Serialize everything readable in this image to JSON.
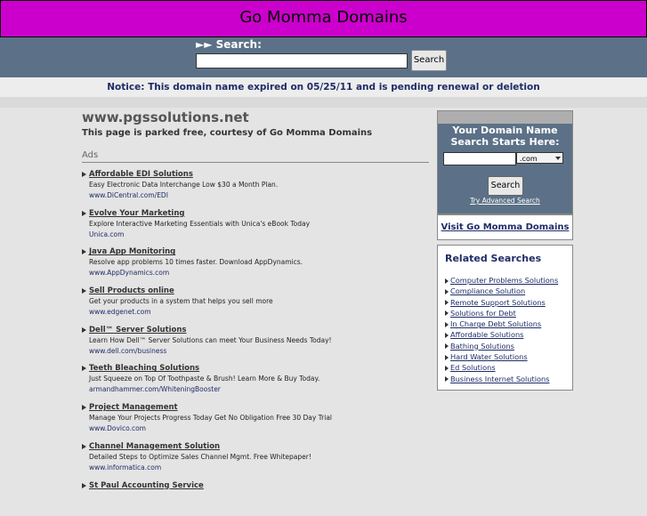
{
  "header": {
    "title": "Go Momma Domains"
  },
  "search": {
    "label": "►► Search:",
    "button": "Search",
    "value": ""
  },
  "notice": "Notice: This domain name expired on 05/25/11 and is pending renewal or deletion",
  "main": {
    "domain": "www.pgssolutions.net",
    "subtitle": "This page is parked free, courtesy of Go Momma Domains",
    "ads_label": "Ads",
    "ads": [
      {
        "title": "Affordable EDI Solutions",
        "desc": "Easy Electronic Data Interchange Low $30 a Month Plan.",
        "url": "www.DiCentral.com/EDI"
      },
      {
        "title": "Evolve Your Marketing",
        "desc": "Explore Interactive Marketing Essentials with Unica's eBook Today",
        "url": "Unica.com"
      },
      {
        "title": "Java App Monitoring",
        "desc": "Resolve app problems 10 times faster. Download AppDynamics.",
        "url": "www.AppDynamics.com"
      },
      {
        "title": "Sell Products online",
        "desc": "Get your products in a system that helps you sell more",
        "url": "www.edgenet.com"
      },
      {
        "title": "Dell™ Server Solutions",
        "desc": "Learn How Dell™ Server Solutions can meet Your Business Needs Today!",
        "url": "www.dell.com/business"
      },
      {
        "title": "Teeth Bleaching Solutions",
        "desc": "Just Squeeze on Top Of Toothpaste & Brush! Learn More & Buy Today.",
        "url": "armandhammer.com/WhiteningBooster"
      },
      {
        "title": "Project Management",
        "desc": "Manage Your Projects Progress Today Get No Obligation Free 30 Day Trial",
        "url": "www.Dovico.com"
      },
      {
        "title": "Channel Management Solution",
        "desc": "Detailed Steps to Optimize Sales Channel Mgmt. Free Whitepaper!",
        "url": "www.informatica.com"
      },
      {
        "title": "St Paul Accounting Service",
        "desc": "",
        "url": ""
      }
    ]
  },
  "sidebar": {
    "heading": "Your Domain Name Search Starts Here:",
    "tld": ".com",
    "search_button": "Search",
    "advanced": "Try Advanced Search",
    "visit": "Visit Go Momma Domains",
    "related_heading": "Related Searches",
    "related": [
      "Computer Problems Solutions",
      "Compliance Solution",
      "Remote Support Solutions",
      "Solutions for Debt",
      "In Charge Debt Solutions",
      "Affordable Solutions",
      "Bathing Solutions",
      "Hard Water Solutions",
      "Ed Solutions",
      "Business Internet Solutions"
    ]
  }
}
